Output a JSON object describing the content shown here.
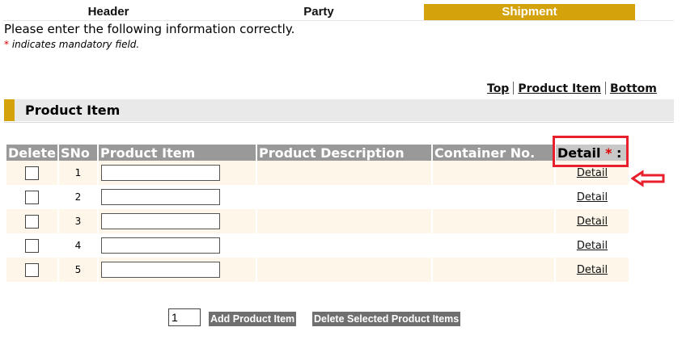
{
  "tabs": [
    "Header",
    "Party",
    "Shipment"
  ],
  "active_tab": "Shipment",
  "accent_color": "#d4a20b",
  "intro_text": "Please enter the following information correctly.",
  "mandatory_star": "*",
  "mandatory_text": " indicates mandatory field.",
  "quick_nav": {
    "top": "Top",
    "product_item": "Product Item",
    "bottom": "Bottom"
  },
  "section_title": "Product Item",
  "table": {
    "headers": {
      "delete": "Delete",
      "sno": "SNo",
      "product_item": "Product Item",
      "product_description": "Product Description",
      "container_no": "Container No.",
      "detail": "Detail",
      "detail_star": "*",
      "detail_colon": " :"
    },
    "rows": [
      {
        "sno": "1",
        "product_item": "",
        "product_description": "",
        "container_no": "",
        "detail": "Detail",
        "checked": false
      },
      {
        "sno": "2",
        "product_item": "",
        "product_description": "",
        "container_no": "",
        "detail": "Detail",
        "checked": false
      },
      {
        "sno": "3",
        "product_item": "",
        "product_description": "",
        "container_no": "",
        "detail": "Detail",
        "checked": false
      },
      {
        "sno": "4",
        "product_item": "",
        "product_description": "",
        "container_no": "",
        "detail": "Detail",
        "checked": false
      },
      {
        "sno": "5",
        "product_item": "",
        "product_description": "",
        "container_no": "",
        "detail": "Detail",
        "checked": false
      }
    ]
  },
  "footer": {
    "count_value": "1",
    "add_button": "Add Product Item",
    "delete_button": "Delete Selected Product Items"
  },
  "annotation_color": "#e8202e"
}
